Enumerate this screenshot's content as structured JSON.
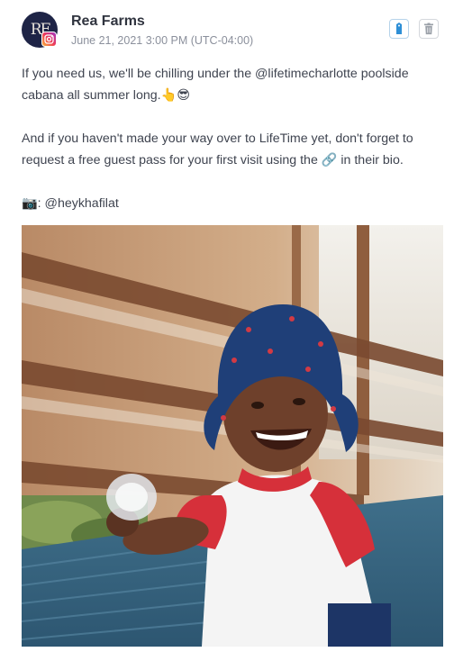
{
  "post": {
    "author": {
      "name": "Rea Farms",
      "avatar_initials": "RF",
      "network": "instagram"
    },
    "date": "June 21, 2021 3:00 PM (UTC-04:00)",
    "actions": [
      {
        "name": "tag",
        "icon": "tag-icon"
      },
      {
        "name": "delete",
        "icon": "trash-icon"
      }
    ],
    "caption": {
      "p1": "If you need us, we'll be chilling under the @lifetimecharlotte poolside cabana all summer long.👆😎",
      "p2": "And if you haven't made your way over to LifeTime yet, don't forget to request a free guest pass for your first visit using the 🔗 in their bio.",
      "p3": "📷: @heykhafilat"
    },
    "image": {
      "description_icon": "photo"
    }
  },
  "colors": {
    "accent": "#2e8fd6",
    "text": "#3f4450",
    "muted": "#8b909c"
  }
}
